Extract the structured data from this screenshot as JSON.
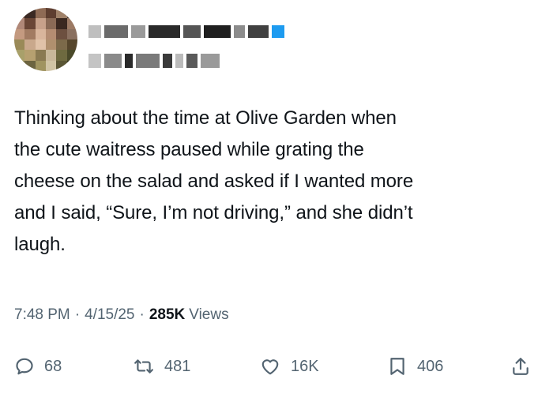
{
  "tweet": {
    "text": "Thinking about the time at Olive Garden when\nthe cute waitress paused while grating the\ncheese on the salad and asked if I wanted more\nand I said, “Sure, I’m not driving,” and she didn’t\nlaugh.",
    "time": "7:48 PM",
    "separator": "·",
    "date": "4/15/25",
    "views_count": "285K",
    "views_label": "Views"
  },
  "actions": {
    "reply_count": "68",
    "repost_count": "481",
    "like_count": "16K",
    "bookmark_count": "406"
  },
  "icons": {
    "reply": "reply-icon",
    "repost": "repost-icon",
    "like": "heart-icon",
    "bookmark": "bookmark-icon",
    "share": "share-icon"
  },
  "colors": {
    "text": "#0f1419",
    "muted": "#536471",
    "redaction_accent": "#1d9bf0"
  }
}
